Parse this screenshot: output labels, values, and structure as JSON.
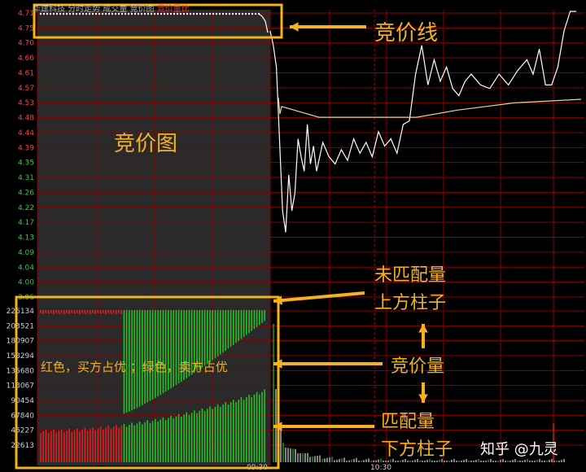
{
  "header": {
    "stock_label": "华建科技",
    "indicator_label": "分时走势",
    "tabs_label": "成交量 竞价图",
    "extra_label": "竞价量比"
  },
  "annotations": {
    "auction_line": "竞价线",
    "auction_chart": "竞价图",
    "unmatched_volume_line1": "未匹配量",
    "unmatched_volume_line2": "上方柱子",
    "auction_volume": "竞价量",
    "matched_volume_line1": "匹配量",
    "matched_volume_line2": "下方柱子",
    "color_legend": "红色，买方占优 ；绿色，卖方占优"
  },
  "watermark": "知乎 @九灵",
  "colors": {
    "annotation": "#f3b21e",
    "grid_red": "#8b0000",
    "buy_red": "#e02020",
    "sell_green": "#22c022",
    "price_line": "#ffffff",
    "avg_line": "#d8d8a0"
  },
  "chart_data": {
    "type": "line",
    "price_ticks": [
      "4.71",
      "4.75",
      "4.70",
      "4.66",
      "4.61",
      "4.57",
      "4.53",
      "4.48",
      "4.44",
      "4.39",
      "4.35",
      "4.31",
      "4.26",
      "4.22",
      "4.17",
      "4.13",
      "4.09",
      "4.04",
      "4.00",
      "3.96"
    ],
    "volume_ticks": [
      "226134",
      "203521",
      "180907",
      "158294",
      "135680",
      "113067",
      "90454",
      "67840",
      "45227",
      "22613"
    ],
    "x_ticks": [
      "09:30",
      "10:30"
    ],
    "ylim": [
      3.96,
      4.79
    ],
    "auction_price": 4.77,
    "open_drop_low": 4.14,
    "avg_line": [
      4.49,
      4.46,
      4.46,
      4.48,
      4.5,
      4.51
    ],
    "price_points": [
      [
        0,
        4.7
      ],
      [
        2,
        4.66
      ],
      [
        4,
        4.6
      ],
      [
        6,
        4.4
      ],
      [
        8,
        4.2
      ],
      [
        10,
        4.14
      ],
      [
        12,
        4.3
      ],
      [
        14,
        4.2
      ],
      [
        16,
        4.25
      ],
      [
        18,
        4.4
      ],
      [
        20,
        4.35
      ],
      [
        22,
        4.31
      ],
      [
        24,
        4.44
      ],
      [
        26,
        4.33
      ],
      [
        28,
        4.38
      ],
      [
        30,
        4.31
      ],
      [
        34,
        4.39
      ],
      [
        38,
        4.35
      ],
      [
        42,
        4.33
      ],
      [
        46,
        4.37
      ],
      [
        50,
        4.34
      ],
      [
        54,
        4.4
      ],
      [
        58,
        4.36
      ],
      [
        62,
        4.39
      ],
      [
        66,
        4.35
      ],
      [
        70,
        4.42
      ],
      [
        74,
        4.38
      ],
      [
        78,
        4.4
      ],
      [
        82,
        4.36
      ],
      [
        86,
        4.44
      ],
      [
        90,
        4.45
      ],
      [
        94,
        4.58
      ],
      [
        98,
        4.66
      ],
      [
        102,
        4.55
      ],
      [
        106,
        4.62
      ],
      [
        110,
        4.56
      ],
      [
        114,
        4.6
      ],
      [
        118,
        4.54
      ],
      [
        122,
        4.52
      ],
      [
        126,
        4.56
      ],
      [
        130,
        4.58
      ],
      [
        136,
        4.55
      ],
      [
        142,
        4.54
      ],
      [
        148,
        4.58
      ],
      [
        154,
        4.55
      ],
      [
        160,
        4.59
      ],
      [
        166,
        4.62
      ],
      [
        170,
        4.58
      ],
      [
        174,
        4.65
      ],
      [
        178,
        4.55
      ],
      [
        182,
        4.55
      ],
      [
        186,
        4.6
      ],
      [
        190,
        4.7
      ],
      [
        194,
        4.78
      ],
      [
        198,
        4.79
      ]
    ]
  }
}
